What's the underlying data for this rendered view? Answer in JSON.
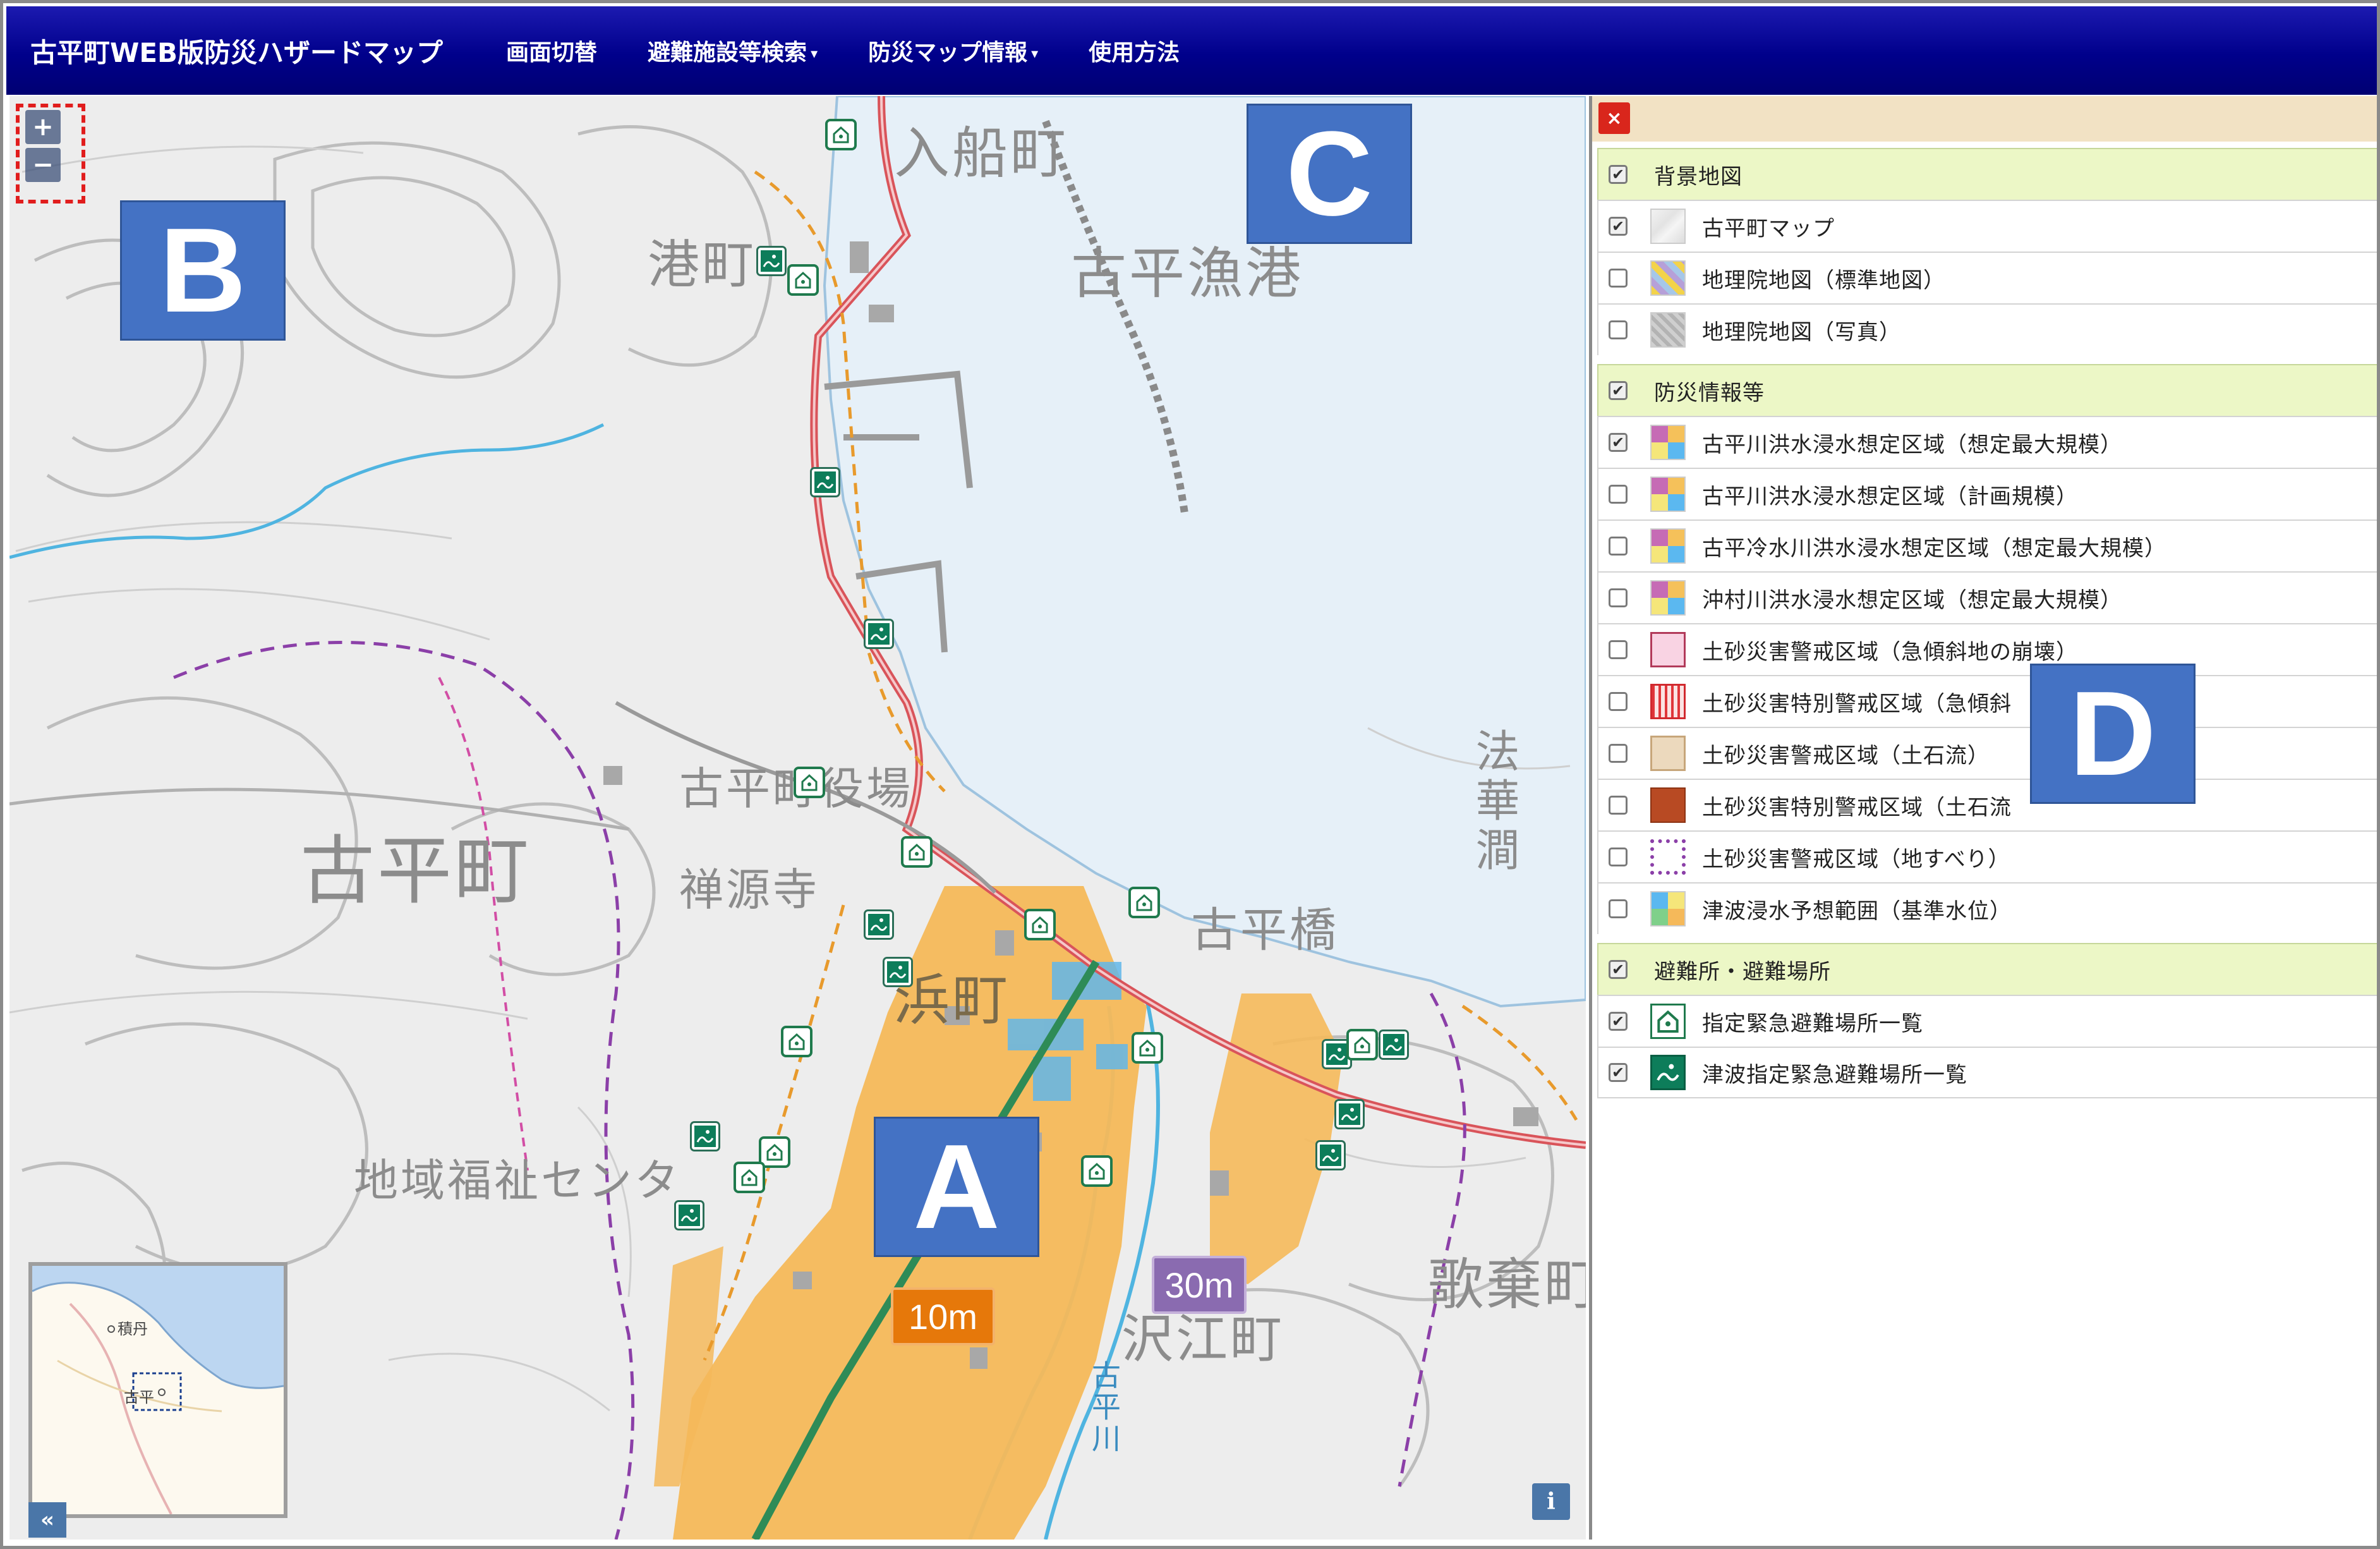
{
  "header": {
    "brand": "古平町WEB版防災ハザードマップ",
    "nav": [
      {
        "label": "画面切替",
        "dropdown": false
      },
      {
        "label": "避難施設等検索",
        "dropdown": true
      },
      {
        "label": "防災マップ情報",
        "dropdown": true
      },
      {
        "label": "使用方法",
        "dropdown": false
      }
    ],
    "caret": "▾"
  },
  "map": {
    "zoom_in": "+",
    "zoom_out": "−",
    "labels": {
      "irifune": "入船町",
      "minato": "港町",
      "gyoko": "古平漁港",
      "furubira": "古平町",
      "yakuba": "古平町役場",
      "zenpoji": "禅源寺",
      "hama": "浜町",
      "fukushi": "地域福祉センタ",
      "bashi": "古平橋",
      "hokekan": "法華澗",
      "utasute": "歌棄町",
      "sawae": "沢江町",
      "kawa": "古平川"
    },
    "depth_tags": {
      "orange": "10m",
      "purple": "30m"
    },
    "annotations": {
      "a": "A",
      "b": "B",
      "c": "C",
      "d": "D"
    },
    "minimap": {
      "label_a": "積丹",
      "label_b": "古平",
      "toggle": "«"
    },
    "info": "i"
  },
  "panel": {
    "close": "×",
    "groups": [
      {
        "label": "背景地図",
        "checked": true,
        "layers": [
          {
            "label": "古平町マップ",
            "checked": true,
            "swatch": "basemap"
          },
          {
            "label": "地理院地図（標準地図）",
            "checked": false,
            "swatch": "gsi-std"
          },
          {
            "label": "地理院地図（写真）",
            "checked": false,
            "swatch": "gsi-photo"
          }
        ]
      },
      {
        "label": "防災情報等",
        "checked": true,
        "layers": [
          {
            "label": "古平川洪水浸水想定区域（想定最大規模）",
            "checked": true,
            "swatch": "flood"
          },
          {
            "label": "古平川洪水浸水想定区域（計画規模）",
            "checked": false,
            "swatch": "flood"
          },
          {
            "label": "古平冷水川洪水浸水想定区域（想定最大規模）",
            "checked": false,
            "swatch": "flood"
          },
          {
            "label": "沖村川洪水浸水想定区域（想定最大規模）",
            "checked": false,
            "swatch": "flood"
          },
          {
            "label": "土砂災害警戒区域（急傾斜地の崩壊）",
            "checked": false,
            "swatch": "pink"
          },
          {
            "label": "土砂災害特別警戒区域（急傾斜",
            "checked": false,
            "swatch": "red-stripe"
          },
          {
            "label": "土砂災害警戒区域（土石流）",
            "checked": false,
            "swatch": "tan"
          },
          {
            "label": "土砂災害特別警戒区域（土石流",
            "checked": false,
            "swatch": "brown"
          },
          {
            "label": "土砂災害警戒区域（地すべり）",
            "checked": false,
            "swatch": "purple-dot"
          },
          {
            "label": "津波浸水予想範囲（基準水位）",
            "checked": false,
            "swatch": "tsunami"
          }
        ]
      },
      {
        "label": "避難所・避難場所",
        "checked": true,
        "layers": [
          {
            "label": "指定緊急避難場所一覧",
            "checked": true,
            "swatch": "shelter-icon"
          },
          {
            "label": "津波指定緊急避難場所一覧",
            "checked": true,
            "swatch": "tsunami-icon"
          }
        ]
      }
    ]
  },
  "colors": {
    "nav_bg": "#00008b",
    "flood_orange": "#f5b95a",
    "water": "#e3eef7",
    "annotation_blue": "#4472c4",
    "road_red": "#d9545a",
    "rail_green": "#2e8b57"
  }
}
